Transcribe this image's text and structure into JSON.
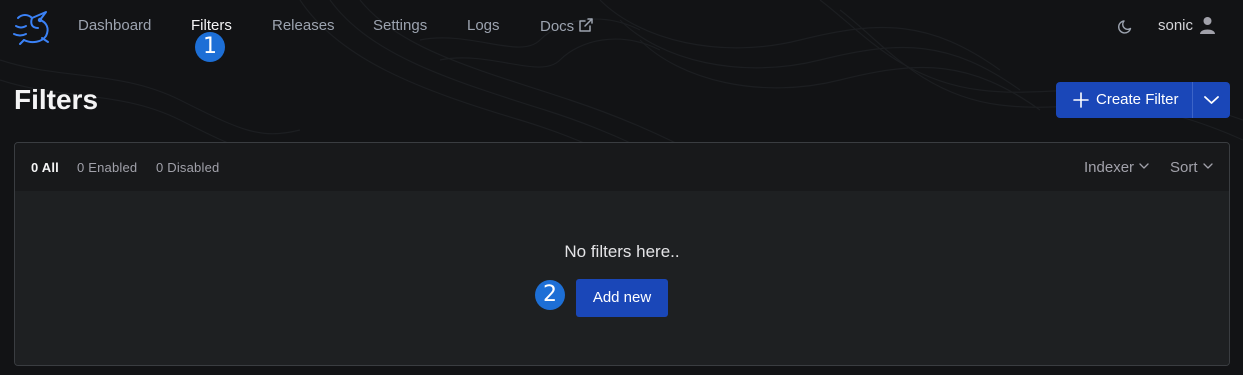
{
  "nav": {
    "items": [
      {
        "label": "Dashboard"
      },
      {
        "label": "Filters"
      },
      {
        "label": "Releases"
      },
      {
        "label": "Settings"
      },
      {
        "label": "Logs"
      },
      {
        "label": "Docs"
      }
    ],
    "active": "Filters",
    "user": "sonic"
  },
  "annotations": {
    "badge1": "1",
    "badge2": "2"
  },
  "header": {
    "title": "Filters",
    "create_label": "Create Filter"
  },
  "panel": {
    "tabs": [
      {
        "label": "0 All"
      },
      {
        "label": "0 Enabled"
      },
      {
        "label": "0 Disabled"
      }
    ],
    "indexer_label": "Indexer",
    "sort_label": "Sort",
    "empty_text": "No filters here..",
    "add_label": "Add new"
  },
  "colors": {
    "background": "#121315",
    "accent": "#1a47b8",
    "badge": "#1d6fd6"
  },
  "icons": [
    "logo-rabbit-icon",
    "external-link-icon",
    "moon-icon",
    "user-icon",
    "plus-icon",
    "chevron-down-icon"
  ]
}
